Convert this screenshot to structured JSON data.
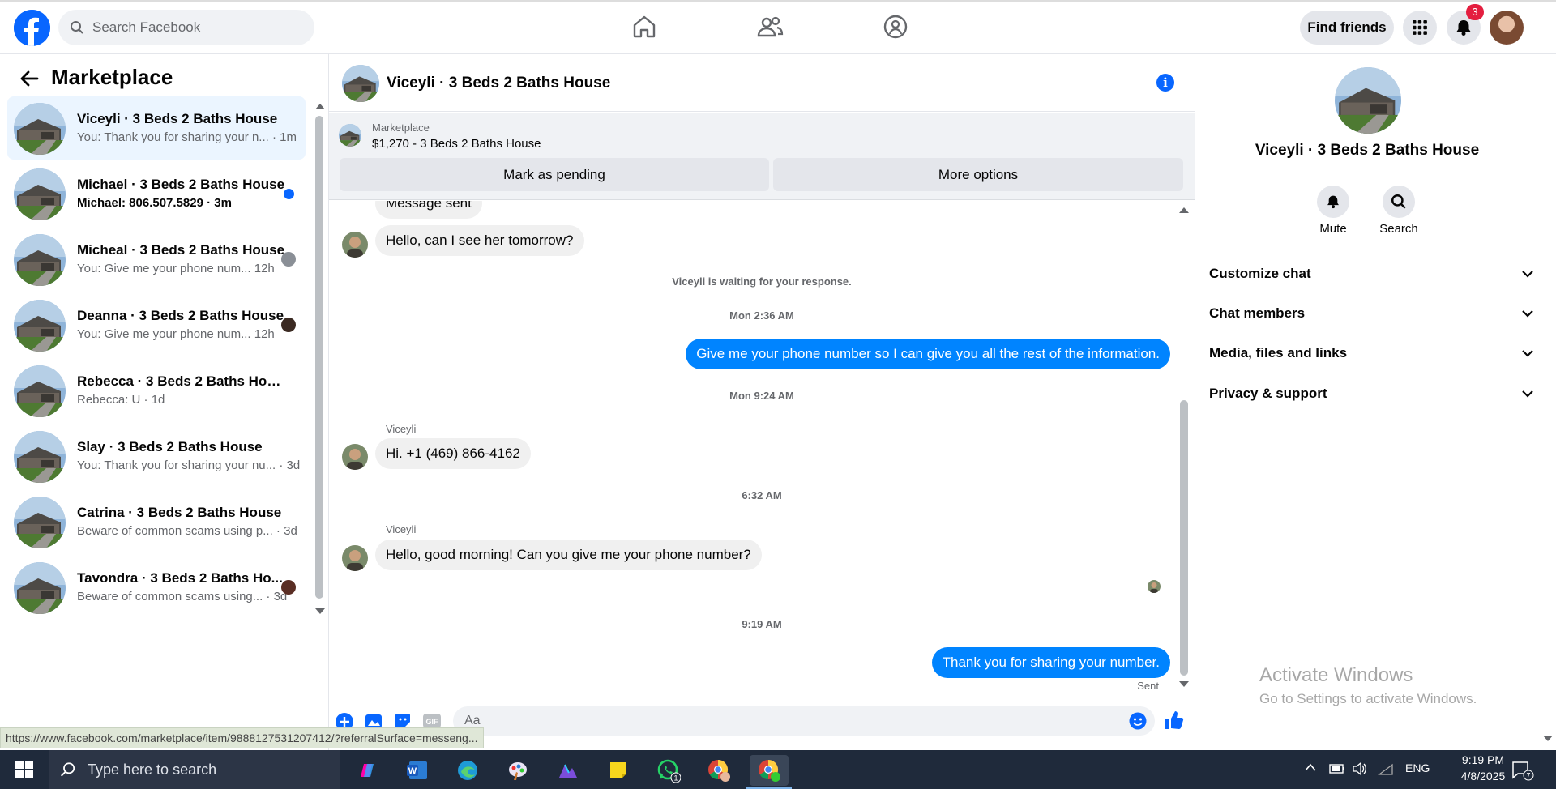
{
  "topbar": {
    "search_placeholder": "Search Facebook",
    "find_friends": "Find friends",
    "notification_count": "3"
  },
  "sidebar": {
    "title": "Marketplace",
    "conversations": [
      {
        "name": "Viceyli · 3 Beds 2 Baths House",
        "snippet": "You: Thank you for sharing your n... · 1m",
        "selected": true
      },
      {
        "name": "Michael · 3 Beds 2 Baths House",
        "snippet": "Michael: 806.507.5829 · 3m",
        "unread": true
      },
      {
        "name": "Micheal · 3 Beds 2 Baths House",
        "snippet": "You: Give me your phone num...  12h"
      },
      {
        "name": "Deanna · 3 Beds 2 Baths House",
        "snippet": "You: Give me your phone num...  12h"
      },
      {
        "name": "Rebecca · 3 Beds 2 Baths House",
        "snippet": "Rebecca: U · 1d"
      },
      {
        "name": "Slay · 3 Beds 2 Baths House",
        "snippet": "You: Thank you for sharing your nu... · 3d"
      },
      {
        "name": "Catrina · 3 Beds 2 Baths House",
        "snippet": "Beware of common scams using p... · 3d"
      },
      {
        "name": "Tavondra · 3 Beds 2 Baths Ho...",
        "snippet": "Beware of common scams using... · 3d"
      }
    ]
  },
  "chat": {
    "title": "Viceyli · 3 Beds 2 Baths House",
    "listing_source": "Marketplace",
    "listing_price": "$1,270 - 3 Beds 2 Baths House",
    "mark_pending": "Mark as pending",
    "more_options": "More options",
    "messages": {
      "partial": "Message sent",
      "m1": "Hello, can I see her tomorrow?",
      "waiting": "Viceyli is waiting for your response.",
      "t1": "Mon 2:36 AM",
      "m2": "Give me your phone number so I can give you all the rest of the information.",
      "t2": "Mon 9:24 AM",
      "sender1": "Viceyli",
      "m3": "Hi. +1 (469) 866-4162",
      "t3": "6:32 AM",
      "sender2": "Viceyli",
      "m4": "Hello, good morning! Can you give me your phone number?",
      "t4": "9:19 AM",
      "m5": "Thank you for sharing your number.",
      "status": "Sent"
    },
    "input_placeholder": "Aa"
  },
  "info_panel": {
    "title": "Viceyli · 3 Beds 2 Baths House",
    "mute": "Mute",
    "search": "Search",
    "sections": [
      "Customize chat",
      "Chat members",
      "Media, files and links",
      "Privacy & support"
    ]
  },
  "watermark": {
    "line1": "Activate Windows",
    "line2": "Go to Settings to activate Windows."
  },
  "status_url": "https://www.facebook.com/marketplace/item/9888127531207412/?referralSurface=messeng...",
  "taskbar": {
    "search_placeholder": "Type here to search",
    "language": "ENG",
    "time": "9:19 PM",
    "date": "4/8/2025",
    "whatsapp_badge": "1",
    "notification_count": "7"
  },
  "colors": {
    "brand": "#0866ff",
    "outgoing_bubble": "#0084ff",
    "selected_row": "#ebf5ff"
  }
}
